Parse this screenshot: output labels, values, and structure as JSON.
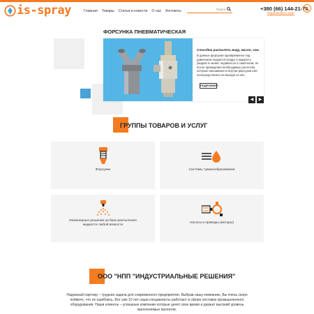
{
  "header": {
    "logo_text": "is-spray",
    "nav": [
      "Главная",
      "Товары",
      "Статьи и новости",
      "О нас",
      "Контакты"
    ],
    "search_placeholder": "Поиск...",
    "phone": "+380 (66) 144-21-76",
    "callback_label": "Перезвонить мне"
  },
  "hero": {
    "title": "ФОРСУНКА ПНЕВМАТИЧЕСКАЯ",
    "subtitle": "Способна распылять воду, масло, сож.",
    "description": "В данные форсунки одновременно под давлением подаются воздух и жидкость (жидкость может подаваться и самотеком, но после проведения необходимых расчетов) которые смешиваются внутри форсунки или непосредственно на выходе из нее.",
    "details_label": "ПОДРОБНЕЕ",
    "prev_label": "◀",
    "next_label": "▶"
  },
  "groups": {
    "title": "ГРУППЫ ТОВАРОВ И УСЛУГ",
    "items": [
      {
        "label": "Форсунки",
        "icon": "nozzle-icon"
      },
      {
        "label": "Системы туманообразования",
        "icon": "fog-system-icon"
      },
      {
        "label": "Инженерные решения на базе распыления жидкости любой вязкости",
        "icon": "spray-cone-icon"
      },
      {
        "label": "Насосы и приводы (моторы)",
        "icon": "pump-motor-icon"
      }
    ]
  },
  "company": {
    "title": "ООО \"НПП \"ИНДУСТРИАЛЬНЫЕ РЕШЕНИЯ\"",
    "text": "Надежный партнер – трудная задача для современного предприятия. Выбрав нашу компанию, Вы очень скоро поймете, что не ошиблись. Вот уже 10 лет наши специалисты работают в сфере поставок промышленного оборудования. Наши клиенты – успешные компании которые ценят свое время и держат высокий уровень выполняемых проектов."
  },
  "colors": {
    "accent": "#f37b21",
    "hero_bg": "#55b6e6",
    "blue_square": "#4aa3d6"
  }
}
